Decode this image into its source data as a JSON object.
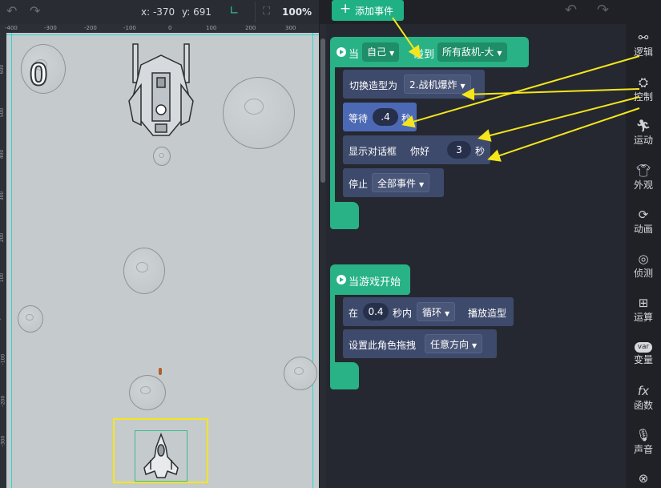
{
  "toolbar": {
    "x_label": "x: -370",
    "y_label": "y: 691",
    "zoom": "100%",
    "add_event": "添加事件"
  },
  "ruler": {
    "h_ticks": [
      "-400",
      "-300",
      "-200",
      "-100",
      "0",
      "100",
      "200",
      "300"
    ],
    "v_ticks": [
      "600",
      "500",
      "400",
      "300",
      "200",
      "100",
      "0",
      "-100",
      "-200",
      "-300"
    ]
  },
  "stage": {
    "score": "0"
  },
  "script1": {
    "when": "当",
    "subject": "自己",
    "touch": "碰到",
    "target": "所有敌机-大",
    "switch_label": "切换造型为",
    "costume": "2.战机爆炸",
    "wait_label": "等待",
    "wait_value": ".4",
    "wait_unit": "秒",
    "dialog_label": "显示对话框",
    "dialog_text": "你好",
    "dialog_secs": "3",
    "dialog_unit": "秒",
    "stop_label": "停止",
    "stop_target": "全部事件"
  },
  "script2": {
    "hat": "当游戏开始",
    "in_label": "在",
    "seconds": "0.4",
    "within": "秒内",
    "mode": "循环",
    "play": "播放造型",
    "drag_label": "设置此角色拖拽",
    "drag_dir": "任意方向"
  },
  "sidebar": {
    "items": [
      {
        "label": "逻辑",
        "icon": "logic-icon"
      },
      {
        "label": "控制",
        "icon": "control-icon"
      },
      {
        "label": "运动",
        "icon": "motion-icon"
      },
      {
        "label": "外观",
        "icon": "appearance-icon"
      },
      {
        "label": "动画",
        "icon": "animation-icon"
      },
      {
        "label": "侦测",
        "icon": "sensing-icon"
      },
      {
        "label": "运算",
        "icon": "operator-icon"
      },
      {
        "label": "变量",
        "icon": "variable-icon"
      },
      {
        "label": "函数",
        "icon": "function-icon"
      },
      {
        "label": "声音",
        "icon": "sound-icon"
      }
    ]
  },
  "colors": {
    "accent_green": "#28b286",
    "annotation_arrow": "#f5e61b",
    "block_dark": "#3e4a6b",
    "block_blue": "#4b69b4"
  }
}
